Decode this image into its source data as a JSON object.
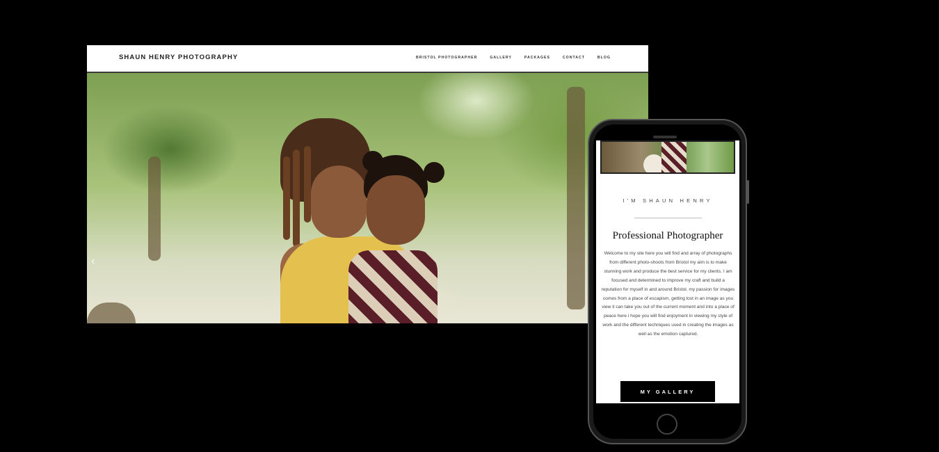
{
  "desktop": {
    "brand": "SHAUN HENRY PHOTOGRAPHY",
    "nav": [
      "BRISTOL PHOTOGRAPHER",
      "GALLERY",
      "PACKAGES",
      "CONTACT",
      "BLOG"
    ],
    "carousel_prev_icon": "chevron-left-icon"
  },
  "mobile": {
    "kicker": "I'M SHAUN HENRY",
    "title": "Professional Photographer",
    "body": "Welcome to my site here you will find and array of photographs from different photo-shoots from Bristol my aim is to make stunning work and produce the best service for my clients. I am focused and determined to improve my craft and build a reputation for myself in and around Bristol. my passion for images comes from a place of escapism, getting lost in an image as you view it can take you out of the current moment and into a place of peace here i hope you will find enjoyment in viewing my style of work and the different techniques used in creating the images as well as the emotion captured.",
    "button": "MY GALLERY"
  },
  "colors": {
    "page_background": "#000000",
    "site_background": "#ffffff",
    "button_background": "#000000"
  }
}
